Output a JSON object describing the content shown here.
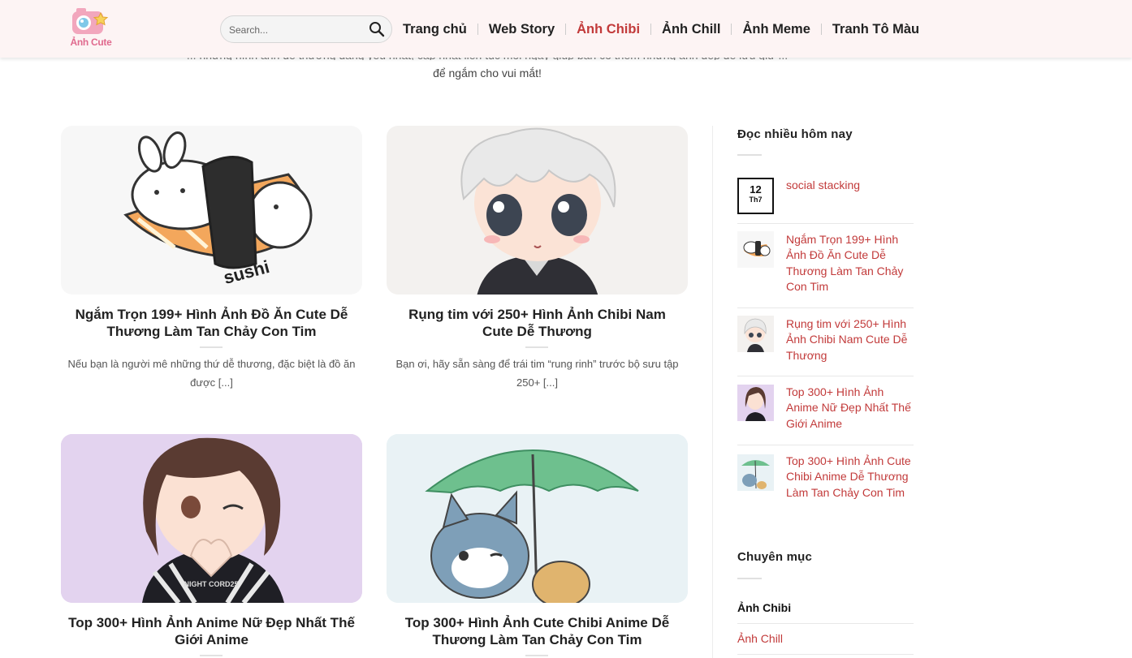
{
  "header": {
    "logo_text": "Ảnh Cute",
    "search_placeholder": "Search...",
    "nav": [
      {
        "label": "Trang chủ",
        "active": false
      },
      {
        "label": "Web Story",
        "active": false
      },
      {
        "label": "Ảnh Chibi",
        "active": true
      },
      {
        "label": "Ảnh Chill",
        "active": false
      },
      {
        "label": "Ảnh Meme",
        "active": false
      },
      {
        "label": "Tranh Tô Màu",
        "active": false
      }
    ]
  },
  "intro": {
    "line_top": "... những hình ảnh dễ thương đáng yêu nhất, cập nhật liên tục mỗi ngày giúp bạn có thêm những ảnh đẹp để lưu giữ ...",
    "line_bottom": "để ngắm cho vui mắt!"
  },
  "posts": [
    {
      "title": "Ngắm Trọn 199+ Hình Ảnh Đồ Ăn Cute Dễ Thương Làm Tan Chảy Con Tim",
      "excerpt": "Nếu bạn là người mê những thứ dễ thương, đặc biệt là đồ ăn được [...]",
      "image_icon": "sushi-bunny-illustration"
    },
    {
      "title": "Rụng tim với 250+ Hình Ảnh Chibi Nam Cute Dễ Thương",
      "excerpt": "Bạn ơi, hãy sẵn sàng để trái tim “rung rinh” trước bộ sưu tập 250+ [...]",
      "image_icon": "chibi-boy-illustration"
    },
    {
      "title": "Top 300+ Hình Ảnh Anime Nữ Đẹp Nhất Thế Giới Anime",
      "excerpt": "",
      "image_icon": "anime-girl-illustration",
      "shirt_text": "NIGHT CORD25"
    },
    {
      "title": "Top 300+ Hình Ảnh Cute Chibi Anime Dễ Thương Làm Tan Chảy Con Tim",
      "excerpt": "",
      "image_icon": "cat-umbrella-illustration"
    }
  ],
  "sushi_label": "sushi",
  "sidebar": {
    "popular_title": "Đọc nhiều hôm nay",
    "popular": [
      {
        "title": "social stacking",
        "date_day": "12",
        "date_month": "Th7"
      },
      {
        "title": "Ngắm Trọn 199+ Hình Ảnh Đồ Ăn Cute Dễ Thương Làm Tan Chảy Con Tim"
      },
      {
        "title": "Rụng tim với 250+ Hình Ảnh Chibi Nam Cute Dễ Thương"
      },
      {
        "title": "Top 300+ Hình Ảnh Anime Nữ Đẹp Nhất Thế Giới Anime"
      },
      {
        "title": "Top 300+ Hình Ảnh Cute Chibi Anime Dễ Thương Làm Tan Chảy Con Tim"
      }
    ],
    "categories_title": "Chuyên mục",
    "categories": [
      {
        "label": "Ảnh Chibi",
        "current": true
      },
      {
        "label": "Ảnh Chill",
        "current": false
      }
    ]
  },
  "colors": {
    "accent": "#c23a3a",
    "header_bg": "#fdf4f4",
    "text": "#222222"
  }
}
